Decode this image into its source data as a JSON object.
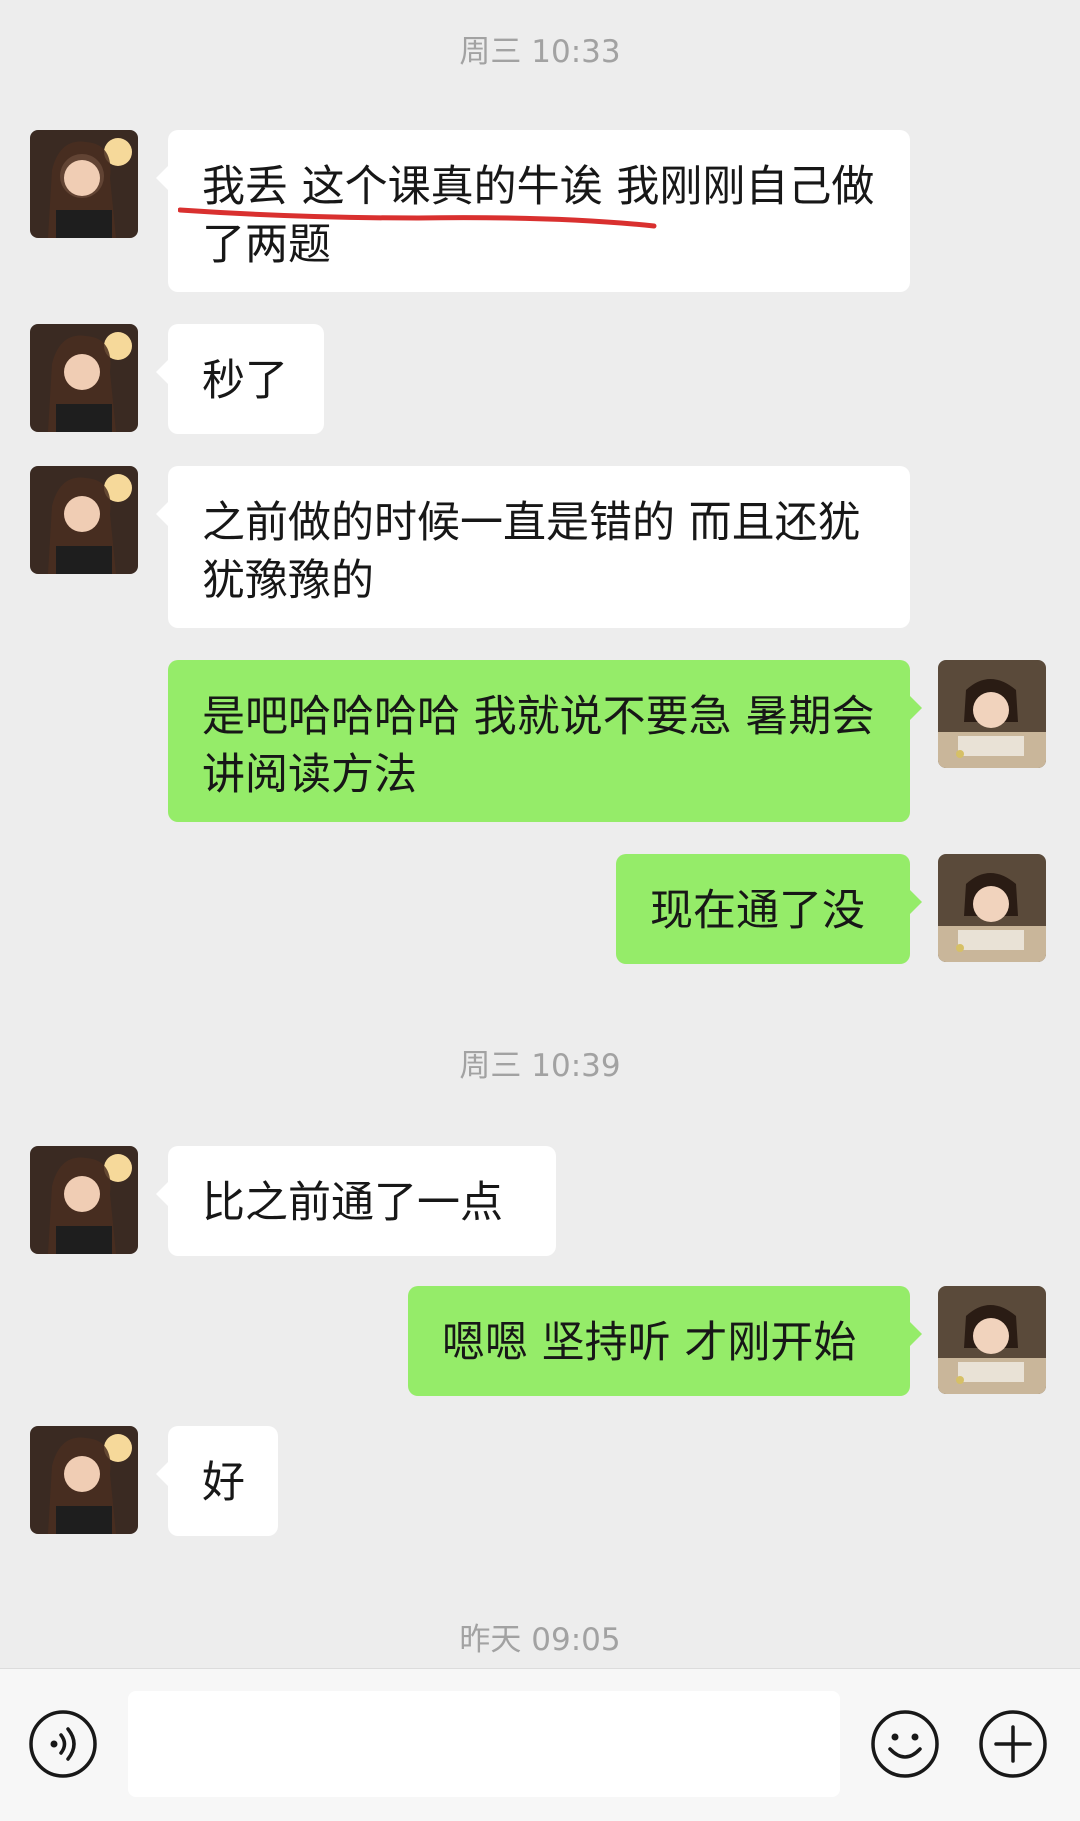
{
  "timestamps": [
    "周三 10:33",
    "周三 10:39",
    "昨天 09:05"
  ],
  "messages": [
    {
      "side": "in",
      "text": "我丢 这个课真的牛诶 我刚刚自己做了两题"
    },
    {
      "side": "in",
      "text": "秒了"
    },
    {
      "side": "in",
      "text": "之前做的时候一直是错的 而且还犹犹豫豫的"
    },
    {
      "side": "out",
      "text": "是吧哈哈哈哈 我就说不要急 暑期会讲阅读方法"
    },
    {
      "side": "out",
      "text": "现在通了没"
    },
    {
      "side": "in",
      "text": "比之前通了一点"
    },
    {
      "side": "out",
      "text": "嗯嗯 坚持听 才刚开始"
    },
    {
      "side": "in",
      "text": "好"
    }
  ],
  "input_bar": {
    "voice_icon": "voice-icon",
    "emoji_icon": "emoji-icon",
    "plus_icon": "plus-icon",
    "input_value": ""
  },
  "colors": {
    "background": "#ededed",
    "bubble_out": "#95ec69",
    "bubble_in": "#ffffff",
    "underline": "#d9302f"
  }
}
